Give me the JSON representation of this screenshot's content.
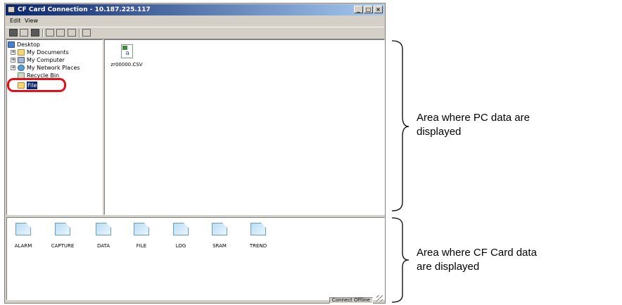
{
  "window": {
    "title": "CF Card Connection - 10.187.225.117",
    "controls": {
      "minimize": "_",
      "maximize": "□",
      "close": "×"
    }
  },
  "menu": [
    "Edit",
    "View"
  ],
  "tree": {
    "items": [
      {
        "label": "Desktop",
        "icon": "desktop-icon",
        "expander": ""
      },
      {
        "label": "My Documents",
        "icon": "folder-icon",
        "expander": "+"
      },
      {
        "label": "My Computer",
        "icon": "computer-icon",
        "expander": "+"
      },
      {
        "label": "My Network Places",
        "icon": "network-icon",
        "expander": "+"
      },
      {
        "label": "Recycle Bin",
        "icon": "recycle-bin-icon",
        "expander": ""
      },
      {
        "label": "File",
        "icon": "folder-icon",
        "expander": "",
        "selected": true
      }
    ]
  },
  "pc_files": [
    {
      "name": "zr00000.CSV",
      "icon": "csv-file-icon"
    }
  ],
  "cf_folders": [
    "ALARM",
    "CAPTURE",
    "DATA",
    "FILE",
    "LOG",
    "SRAM",
    "TREND"
  ],
  "status": "Connect Offline",
  "annotations": {
    "pc_area": [
      "Area where PC data are",
      "displayed"
    ],
    "cf_area": [
      "Area where CF Card data",
      "are displayed"
    ]
  },
  "colors": {
    "highlight": "#e3101a",
    "titlebar": "#0a246a"
  }
}
